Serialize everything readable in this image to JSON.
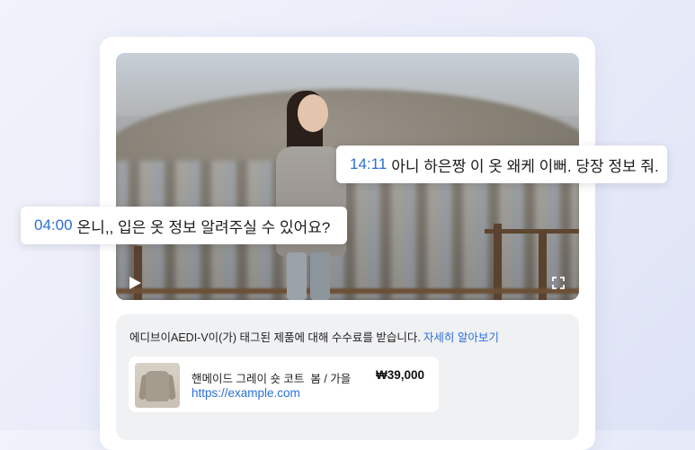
{
  "video": {
    "captions": [
      {
        "time": "14:11",
        "text": "아니 하은짱 이 옷 왜케 이뻐. 당장 정보 줘."
      },
      {
        "time": "04:00",
        "text": "온니,, 입은 옷 정보 알려주실 수 있어요?"
      }
    ],
    "controls": {
      "play_icon": "play-icon",
      "fullscreen_icon": "fullscreen-icon"
    }
  },
  "disclosure": {
    "text": "에디브이AEDI-V이(가) 태그된 제품에 대해 수수료를 받습니다.",
    "link_label": "자세히 알아보기"
  },
  "product": {
    "name": "핸메이드 그레이 숏 코트  봄 / 가을",
    "price": "₩39,000",
    "url": "https://example.com"
  },
  "colors": {
    "accent": "#2a6fd6",
    "card": "#ffffff",
    "panel": "#f0f1f3"
  }
}
